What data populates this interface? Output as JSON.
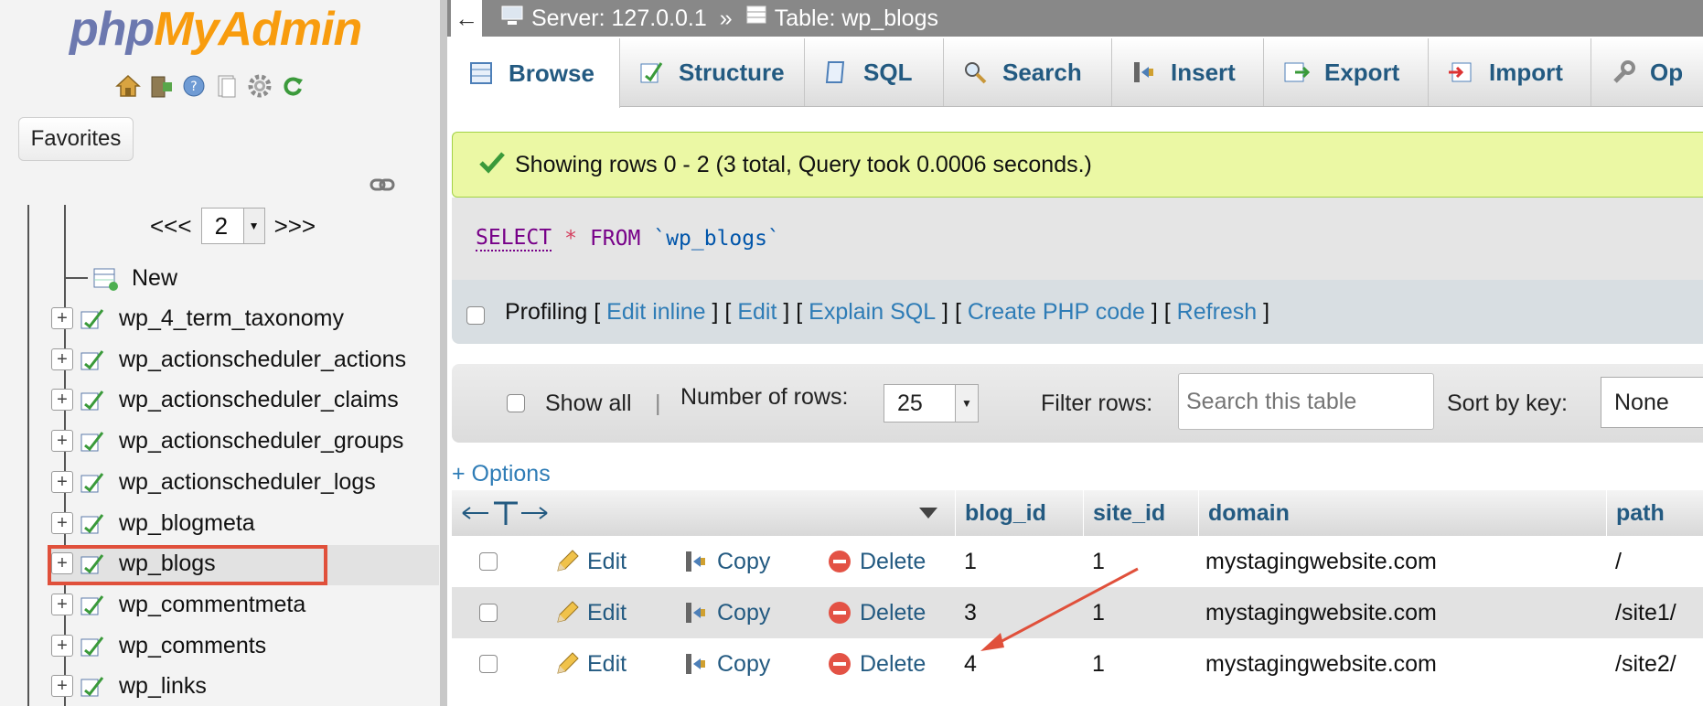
{
  "logo": {
    "part1": "php",
    "part2": "MyAdmin"
  },
  "sidebar": {
    "favorites_label": "Favorites",
    "pager": {
      "prev": "<<<",
      "page": "2",
      "next": ">>>"
    },
    "new_label": "New",
    "tables": [
      "wp_4_term_taxonomy",
      "wp_actionscheduler_actions",
      "wp_actionscheduler_claims",
      "wp_actionscheduler_groups",
      "wp_actionscheduler_logs",
      "wp_blogmeta",
      "wp_blogs",
      "wp_commentmeta",
      "wp_comments",
      "wp_links"
    ],
    "selected_table": "wp_blogs"
  },
  "topbar": {
    "back": "←",
    "server": "Server: 127.0.0.1",
    "sep": "»",
    "table": "Table: wp_blogs"
  },
  "tabs": [
    "Browse",
    "Structure",
    "SQL",
    "Search",
    "Insert",
    "Export",
    "Import",
    "Op"
  ],
  "success_msg": "Showing rows 0 - 2 (3 total, Query took 0.0006 seconds.)",
  "sql": {
    "select": "SELECT",
    "star": "*",
    "from": "FROM",
    "table": "`wp_blogs`"
  },
  "profiling": {
    "label": "Profiling",
    "links": [
      "Edit inline",
      "Edit",
      "Explain SQL",
      "Create PHP code",
      "Refresh"
    ]
  },
  "nav": {
    "show_all": "Show all",
    "num_rows_label": "Number of rows:",
    "num_rows": "25",
    "filter_label": "Filter rows:",
    "filter_placeholder": "Search this table",
    "sort_label": "Sort by key:",
    "sort_value": "None"
  },
  "options_label": "+ Options",
  "table": {
    "columns": [
      "blog_id",
      "site_id",
      "domain",
      "path"
    ],
    "actions": {
      "edit": "Edit",
      "copy": "Copy",
      "delete": "Delete"
    },
    "rows": [
      {
        "blog_id": "1",
        "site_id": "1",
        "domain": "mystagingwebsite.com",
        "path": "/"
      },
      {
        "blog_id": "3",
        "site_id": "1",
        "domain": "mystagingwebsite.com",
        "path": "/site1/"
      },
      {
        "blog_id": "4",
        "site_id": "1",
        "domain": "mystagingwebsite.com",
        "path": "/site2/"
      }
    ]
  },
  "colors": {
    "accent_link": "#235a81",
    "highlight_box": "#e0503b",
    "success_bg": "#ebf8a4",
    "arrow": "#e0503b"
  }
}
